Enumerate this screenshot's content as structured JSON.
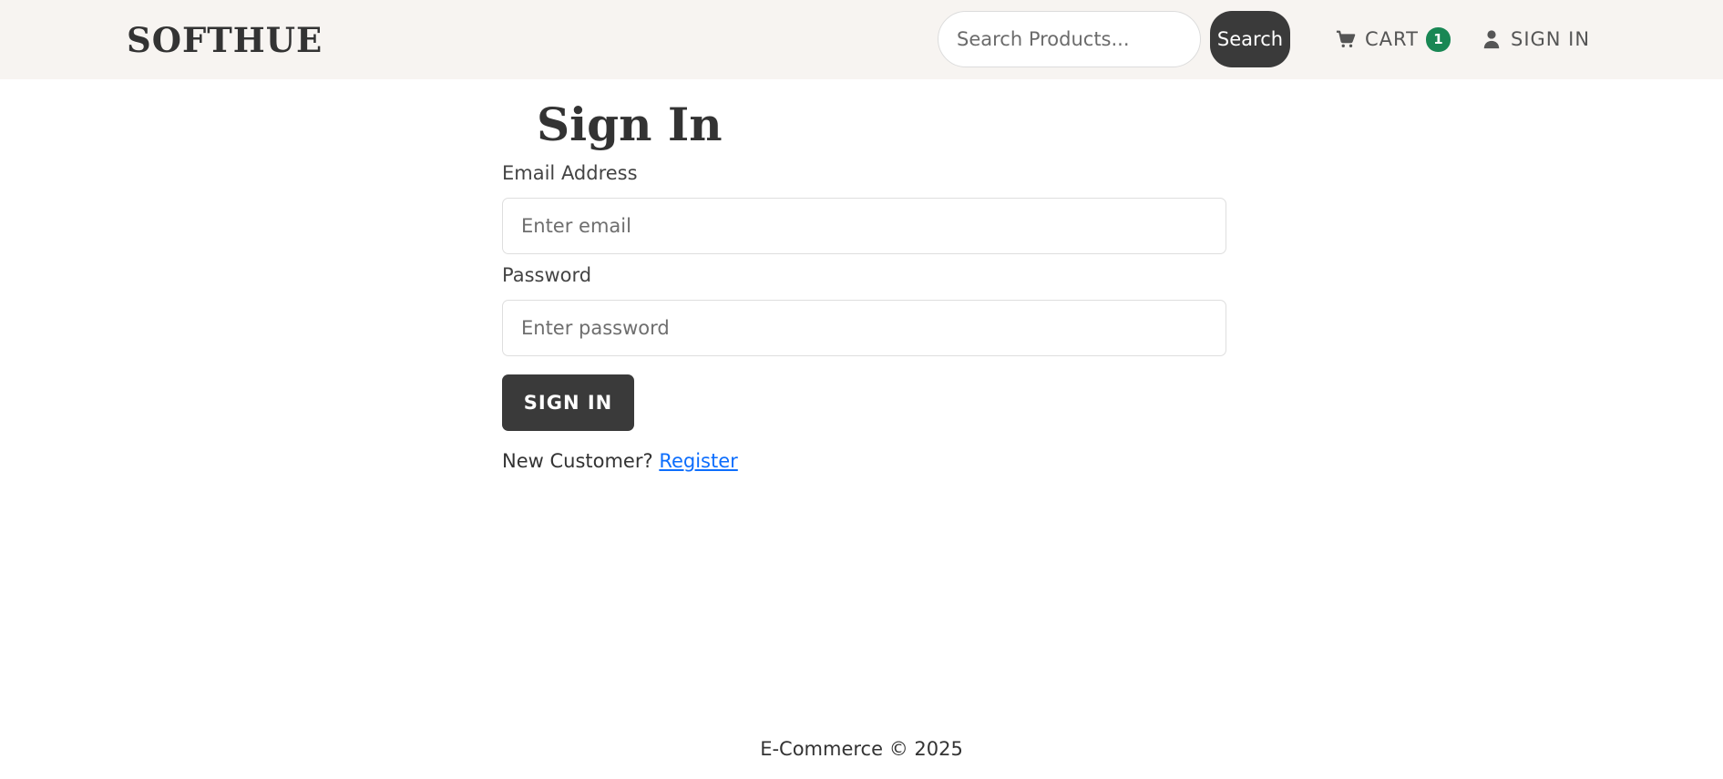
{
  "header": {
    "brand": "SOFTHUE",
    "search": {
      "placeholder": "Search Products...",
      "button_label": "Search"
    },
    "cart": {
      "label": "CART",
      "count": "1",
      "icon": "cart-icon",
      "badge_color": "#198754"
    },
    "signin": {
      "label": "SIGN IN",
      "icon": "user-icon"
    }
  },
  "main": {
    "title": "Sign In",
    "email": {
      "label": "Email Address",
      "placeholder": "Enter email"
    },
    "password": {
      "label": "Password",
      "placeholder": "Enter password"
    },
    "submit_label": "SIGN IN",
    "new_customer_text": "New Customer?",
    "register_link": "Register"
  },
  "footer": {
    "text": "E-Commerce © 2025"
  },
  "colors": {
    "header_bg": "#f7f4f1",
    "primary_button": "#3a3a3a",
    "link": "#0d6efd"
  }
}
